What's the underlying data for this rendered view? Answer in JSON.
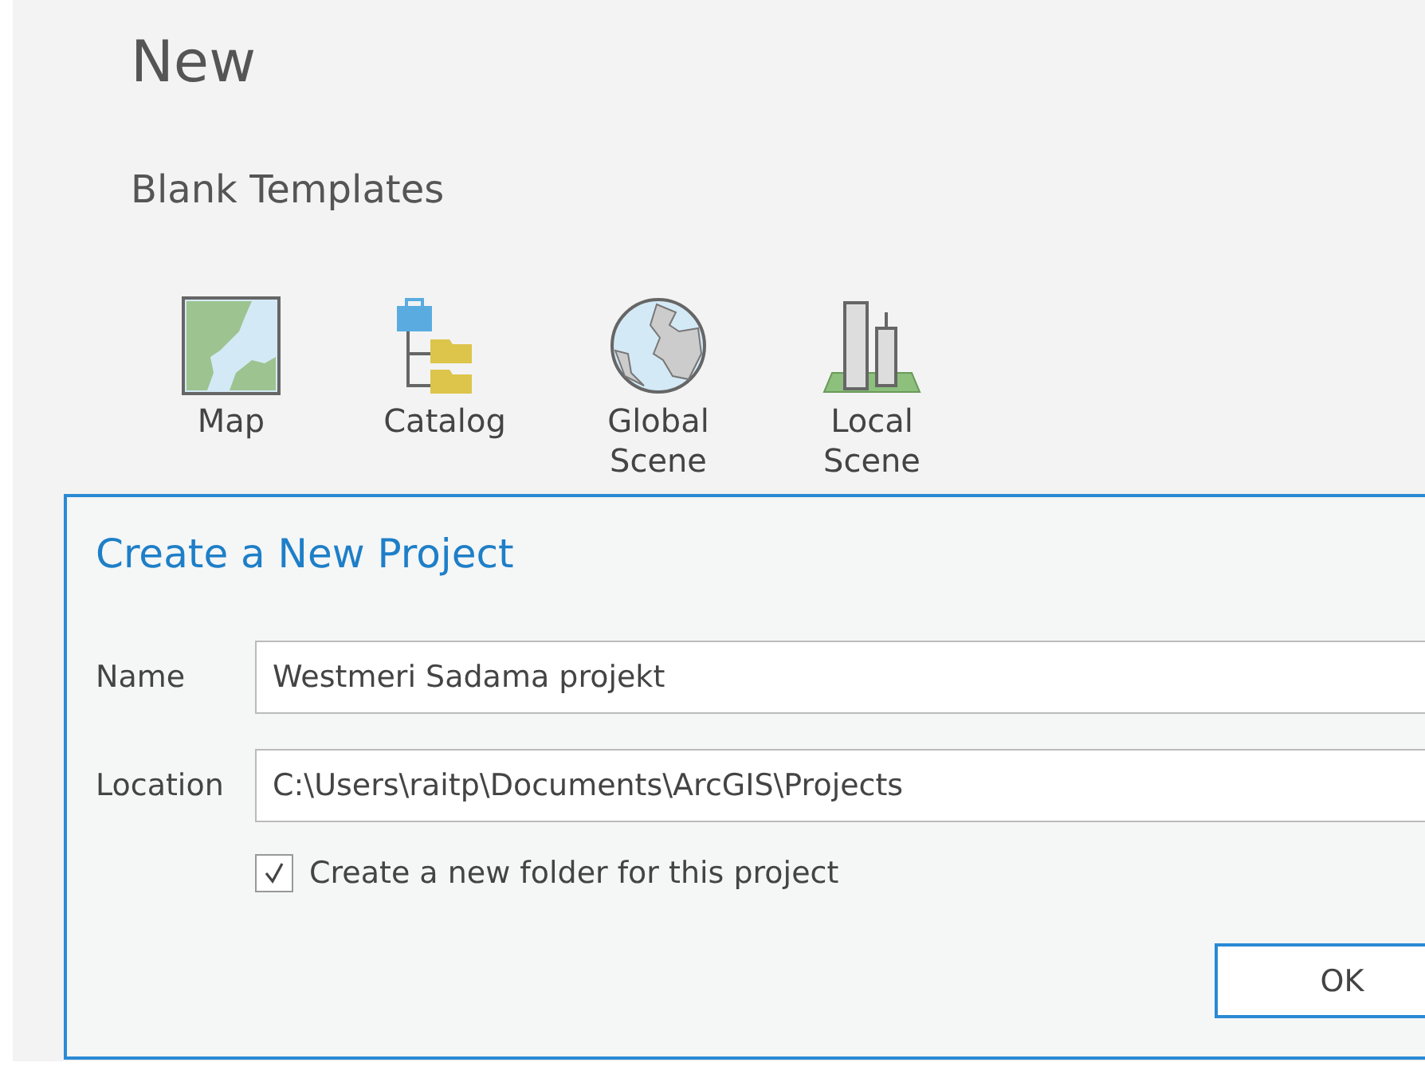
{
  "page_title": "New",
  "section_title": "Blank Templates",
  "templates": [
    {
      "kind": "map",
      "label": "Map"
    },
    {
      "kind": "catalog",
      "label": "Catalog"
    },
    {
      "kind": "globe",
      "label": "Global Scene"
    },
    {
      "kind": "local",
      "label": "Local Scene"
    }
  ],
  "dialog": {
    "title": "Create a New Project",
    "name_label": "Name",
    "name_value": "Westmeri Sadama projekt",
    "location_label": "Location",
    "location_value": "C:\\Users\\raitp\\Documents\\ArcGIS\\Projects",
    "folder_checkbox": {
      "label": "Create a new folder for this project",
      "checked": true
    },
    "ok_button": "OK"
  }
}
